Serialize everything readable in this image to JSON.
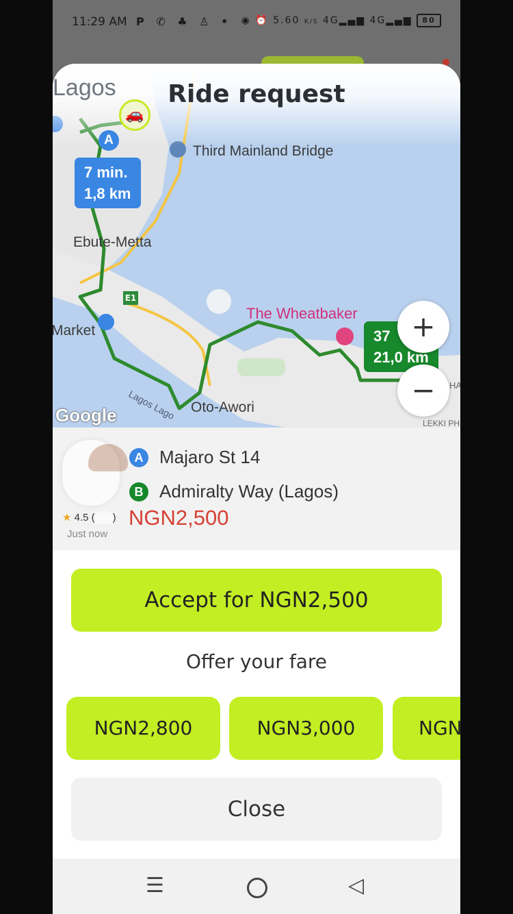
{
  "status_bar": {
    "time": "11:29 AM",
    "left_icons": [
      "parking-icon",
      "whatsapp-icon",
      "android-icon",
      "notification-icon",
      "dot-icon"
    ],
    "network_speed": "5.60",
    "network_speed_unit": "K/S",
    "network_1": "4G",
    "network_2": "4G",
    "battery": "80"
  },
  "sheet": {
    "title": "Ride request"
  },
  "map": {
    "labels": {
      "city": "Lagos",
      "bridge": "Third Mainland Bridge",
      "ebute": "Ebute-Metta",
      "market": "Market",
      "wheatbaker": "The Wheatbaker",
      "oto": "Oto-Awori",
      "lagos_lagoon": "Lagos Lago",
      "lekki": "LEKKI PH",
      "ha": "HA",
      "highway": "E1",
      "google": "Google"
    },
    "pickup_box": {
      "line1": "7 min.",
      "line2": "1,8 km"
    },
    "trip_box": {
      "line1": "37",
      "line2": "21,0 km"
    },
    "pin_a": "A",
    "zoom_in": "+",
    "zoom_out": "−"
  },
  "request": {
    "rating": "4.5 (",
    "rating_end": ")",
    "time": "Just now",
    "pickup_letter": "A",
    "pickup": "Majaro St 14",
    "dropoff_letter": "B",
    "dropoff": "Admiralty Way (Lagos)",
    "price": "NGN2,500"
  },
  "actions": {
    "accept_label": "Accept for NGN2,500",
    "offer_title": "Offer your fare",
    "fares": [
      "NGN2,800",
      "NGN3,000",
      "NGN"
    ],
    "close_label": "Close"
  },
  "colors": {
    "accent": "#c2ee23",
    "route": "#17882c",
    "price": "#d64034",
    "pin_a": "#3a86e3"
  }
}
